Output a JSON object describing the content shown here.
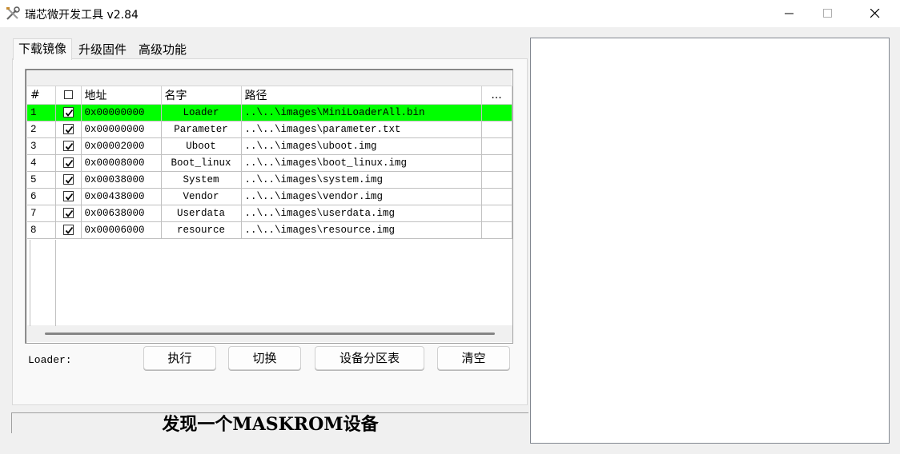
{
  "window": {
    "title": "瑞芯微开发工具 v2.84",
    "app_icon": "tools-icon"
  },
  "tabs": [
    {
      "label": "下载镜像",
      "active": true
    },
    {
      "label": "升级固件",
      "active": false
    },
    {
      "label": "高级功能",
      "active": false
    }
  ],
  "table": {
    "columns": [
      "#",
      "",
      "地址",
      "名字",
      "路径",
      "..."
    ],
    "rows": [
      {
        "num": "1",
        "checked": true,
        "address": "0x00000000",
        "name": "Loader",
        "path": "..\\..\\images\\MiniLoaderAll.bin",
        "selected": true
      },
      {
        "num": "2",
        "checked": true,
        "address": "0x00000000",
        "name": "Parameter",
        "path": "..\\..\\images\\parameter.txt",
        "selected": false
      },
      {
        "num": "3",
        "checked": true,
        "address": "0x00002000",
        "name": "Uboot",
        "path": "..\\..\\images\\uboot.img",
        "selected": false
      },
      {
        "num": "4",
        "checked": true,
        "address": "0x00008000",
        "name": "Boot_linux",
        "path": "..\\..\\images\\boot_linux.img",
        "selected": false
      },
      {
        "num": "5",
        "checked": true,
        "address": "0x00038000",
        "name": "System",
        "path": "..\\..\\images\\system.img",
        "selected": false
      },
      {
        "num": "6",
        "checked": true,
        "address": "0x00438000",
        "name": "Vendor",
        "path": "..\\..\\images\\vendor.img",
        "selected": false
      },
      {
        "num": "7",
        "checked": true,
        "address": "0x00638000",
        "name": "Userdata",
        "path": "..\\..\\images\\userdata.img",
        "selected": false
      },
      {
        "num": "8",
        "checked": true,
        "address": "0x00006000",
        "name": "resource",
        "path": "..\\..\\images\\resource.img",
        "selected": false
      }
    ],
    "selected_color": "#00ff00"
  },
  "actions": {
    "loader_label": "Loader:",
    "execute": "执行",
    "switch": "切换",
    "partition_table": "设备分区表",
    "clear": "清空"
  },
  "status": {
    "text": "发现一个MASKROM设备"
  }
}
